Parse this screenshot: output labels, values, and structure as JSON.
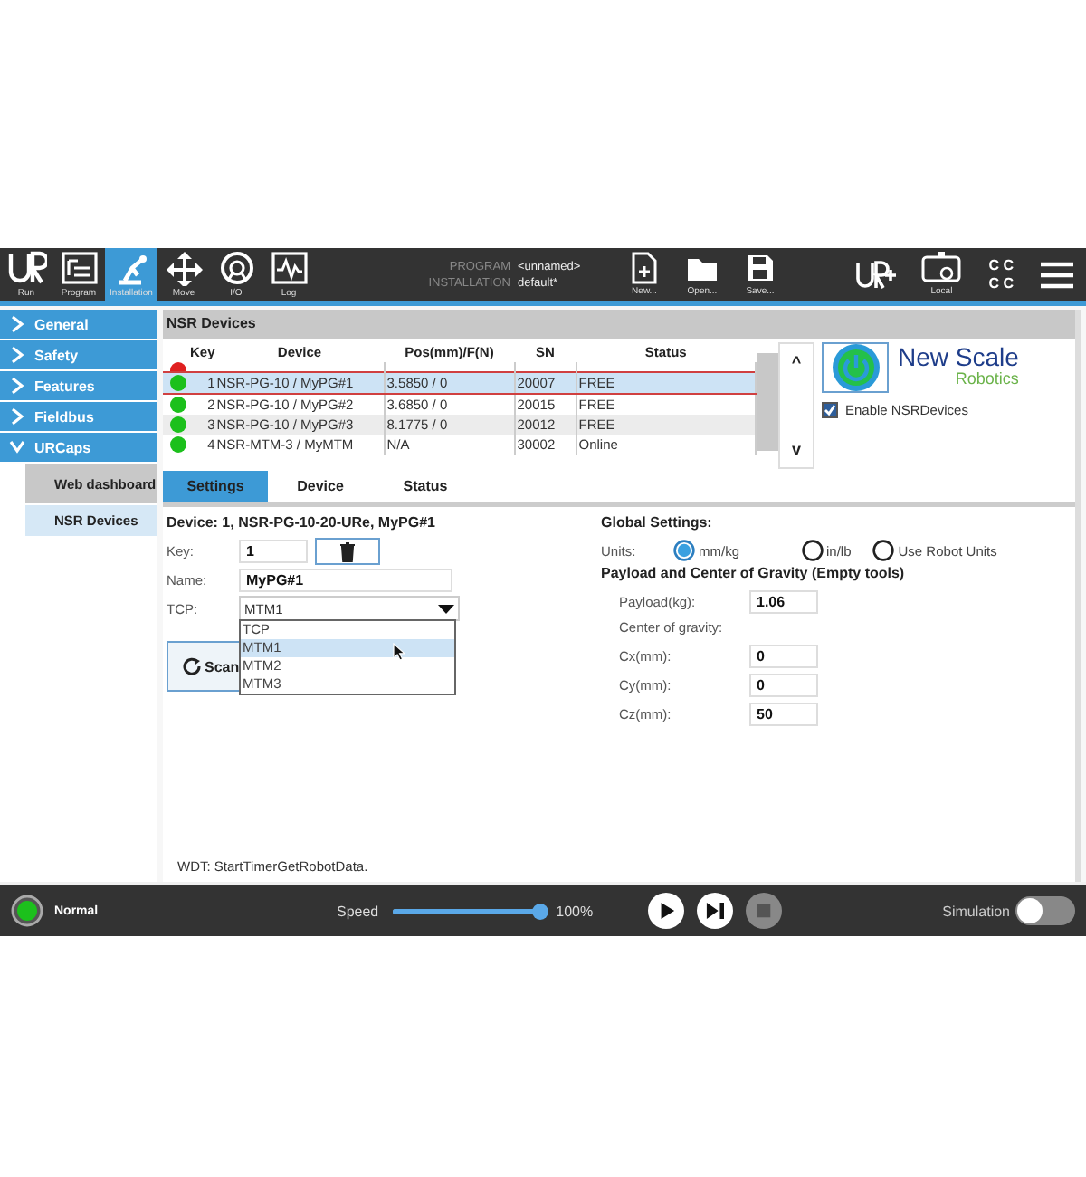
{
  "toolbar": {
    "tabs": [
      {
        "label": "Run",
        "kind": "run",
        "selected": false
      },
      {
        "label": "Program",
        "kind": "program",
        "selected": false
      },
      {
        "label": "Installation",
        "kind": "installation",
        "selected": true
      },
      {
        "label": "Move",
        "kind": "move",
        "selected": false
      },
      {
        "label": "I/O",
        "kind": "io",
        "selected": false
      },
      {
        "label": "Log",
        "kind": "log",
        "selected": false
      }
    ],
    "program_label": "PROGRAM",
    "program_value": "<unnamed>",
    "installation_label": "INSTALLATION",
    "installation_value": "default*",
    "file_buttons": [
      {
        "label": "New...",
        "kind": "new"
      },
      {
        "label": "Open...",
        "kind": "open"
      },
      {
        "label": "Save...",
        "kind": "save"
      }
    ],
    "local_label": "Local",
    "cc_text": [
      "C C",
      "C C"
    ]
  },
  "sidebar": {
    "items": [
      {
        "label": "General",
        "expanded": false,
        "selected": false
      },
      {
        "label": "Safety",
        "expanded": false,
        "selected": false
      },
      {
        "label": "Features",
        "expanded": false,
        "selected": false
      },
      {
        "label": "Fieldbus",
        "expanded": false,
        "selected": false
      },
      {
        "label": "URCaps",
        "expanded": true,
        "selected": false,
        "children": [
          {
            "label": "Web dashboard",
            "selected": false
          },
          {
            "label": "NSR Devices",
            "selected": true
          }
        ]
      }
    ]
  },
  "panel": {
    "title": "NSR Devices",
    "table": {
      "columns": [
        "Key",
        "Device",
        "Pos(mm)/F(N)",
        "SN",
        "Status"
      ],
      "rows": [
        {
          "color": "#e02020",
          "selected": false
        },
        {
          "color": "#1cc01c",
          "selected": true,
          "cells": [
            "1",
            "NSR-PG-10 / MyPG#1",
            "3.5850 / 0",
            "20007",
            "FREE"
          ]
        },
        {
          "color": "#1cc01c",
          "selected": false,
          "cells": [
            "2",
            "NSR-PG-10 / MyPG#2",
            "3.6850 / 0",
            "20015",
            "FREE"
          ]
        },
        {
          "color": "#1cc01c",
          "selected": false,
          "cells": [
            "3",
            "NSR-PG-10 / MyPG#3",
            "8.1775 / 0",
            "20012",
            "FREE"
          ]
        },
        {
          "color": "#1cc01c",
          "selected": false,
          "cells": [
            "4",
            "NSR-MTM-3 / MyMTM",
            "N/A",
            "30002",
            "Online"
          ]
        }
      ]
    },
    "scroll_up": "^",
    "scroll_down": "v",
    "logo": {
      "line1": "New Scale",
      "line2": "Robotics"
    },
    "enable": {
      "label": "Enable NSRDevices",
      "checked": true
    },
    "tabs": [
      {
        "label": "Settings",
        "selected": true
      },
      {
        "label": "Device",
        "selected": false
      },
      {
        "label": "Status",
        "selected": false
      }
    ],
    "device_title": "Device: 1, NSR-PG-10-20-URe, MyPG#1",
    "key_label": "Key:",
    "key_value": "1",
    "name_label": "Name:",
    "name_value": "MyPG#1",
    "tcp_label": "TCP:",
    "tcp_value": "MTM1",
    "tcp_options": [
      {
        "label": "TCP",
        "selected": false
      },
      {
        "label": "MTM1",
        "selected": true
      },
      {
        "label": "MTM2",
        "selected": false
      },
      {
        "label": "MTM3",
        "selected": false
      }
    ],
    "scan_button": "Scan",
    "global_title": "Global Settings:",
    "units_label": "Units:",
    "units": [
      {
        "label": "mm/kg",
        "selected": true
      },
      {
        "label": "in/lb",
        "selected": false
      },
      {
        "label": "Use Robot Units",
        "selected": false
      }
    ],
    "payload_title": "Payload and Center of Gravity (Empty tools)",
    "payload_fields": [
      {
        "label": "Payload(kg):",
        "value": "1.06"
      }
    ],
    "cog_label": "Center of gravity:",
    "cog_fields": [
      {
        "label": "Cx(mm):",
        "value": "0"
      },
      {
        "label": "Cy(mm):",
        "value": "0"
      },
      {
        "label": "Cz(mm):",
        "value": "50"
      }
    ],
    "message": "WDT: StartTimerGetRobotData."
  },
  "status_bar": {
    "state": "Normal",
    "speed_label": "Speed",
    "speed": {
      "level": 1.0
    },
    "speed_text": "100%",
    "controls": [
      {
        "kind": "play",
        "disabled": false
      },
      {
        "kind": "step",
        "disabled": false
      },
      {
        "kind": "stop",
        "disabled": true
      }
    ],
    "simulation_label": "Simulation",
    "simulation_on": false
  }
}
